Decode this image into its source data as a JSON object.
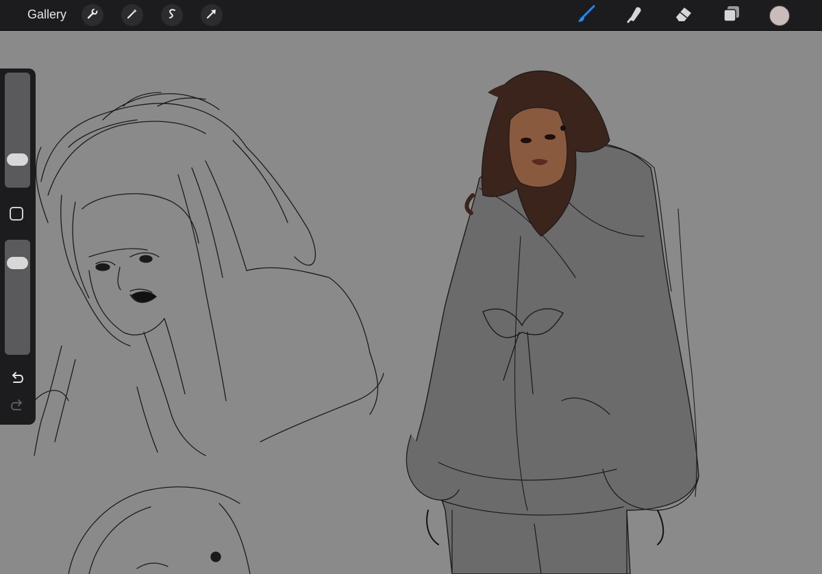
{
  "topbar": {
    "gallery_label": "Gallery",
    "left_tools": [
      {
        "icon": "wrench-icon",
        "name": "actions"
      },
      {
        "icon": "magic-wand-icon",
        "name": "adjustments"
      },
      {
        "icon": "selection-s-icon",
        "name": "selection"
      },
      {
        "icon": "arrow-cursor-icon",
        "name": "transform"
      }
    ],
    "right_tools": [
      {
        "icon": "brush-icon",
        "name": "paint",
        "active": true
      },
      {
        "icon": "smudge-icon",
        "name": "smudge",
        "active": false
      },
      {
        "icon": "eraser-icon",
        "name": "erase",
        "active": false
      },
      {
        "icon": "layers-icon",
        "name": "layers",
        "active": false
      }
    ],
    "current_color": "#c9bcbb",
    "active_color": "#1a8cff"
  },
  "sidebar": {
    "brush_size_level": 0.2,
    "opacity_level": 0.85,
    "undo_icon": "undo-icon",
    "redo_icon": "redo-icon",
    "modify_icon": "square-modify-icon"
  },
  "canvas": {
    "background": "#8a8a8a",
    "jacket_fill": "#6b6b6b",
    "hair_color": "#3a241c",
    "skin_color": "#8a5a3e"
  }
}
